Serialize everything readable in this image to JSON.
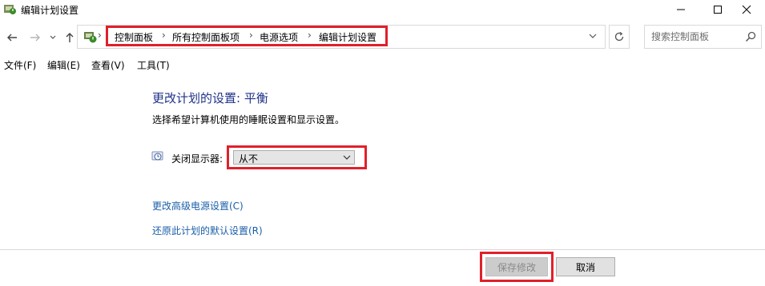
{
  "window": {
    "title": "编辑计划设置",
    "controls": [
      "minimize-icon",
      "maximize-icon",
      "close-icon"
    ]
  },
  "address_bar": {
    "breadcrumbs": [
      "控制面板",
      "所有控制面板项",
      "电源选项",
      "编辑计划设置"
    ],
    "separator": "›"
  },
  "search": {
    "placeholder": "搜索控制面板"
  },
  "menu": {
    "items": [
      "文件(F)",
      "编辑(E)",
      "查看(V)",
      "工具(T)"
    ]
  },
  "main": {
    "heading": "更改计划的设置: 平衡",
    "description": "选择希望计算机使用的睡眠设置和显示设置。",
    "display_off": {
      "label": "关闭显示器:",
      "selected": "从不"
    },
    "links": {
      "advanced": "更改高级电源设置(C)",
      "restore": "还原此计划的默认设置(R)"
    }
  },
  "footer": {
    "save_label": "保存修改",
    "cancel_label": "取消"
  },
  "colors": {
    "highlight_border": "#e0202a",
    "heading": "#1e3287",
    "link": "#1a5fa8"
  }
}
